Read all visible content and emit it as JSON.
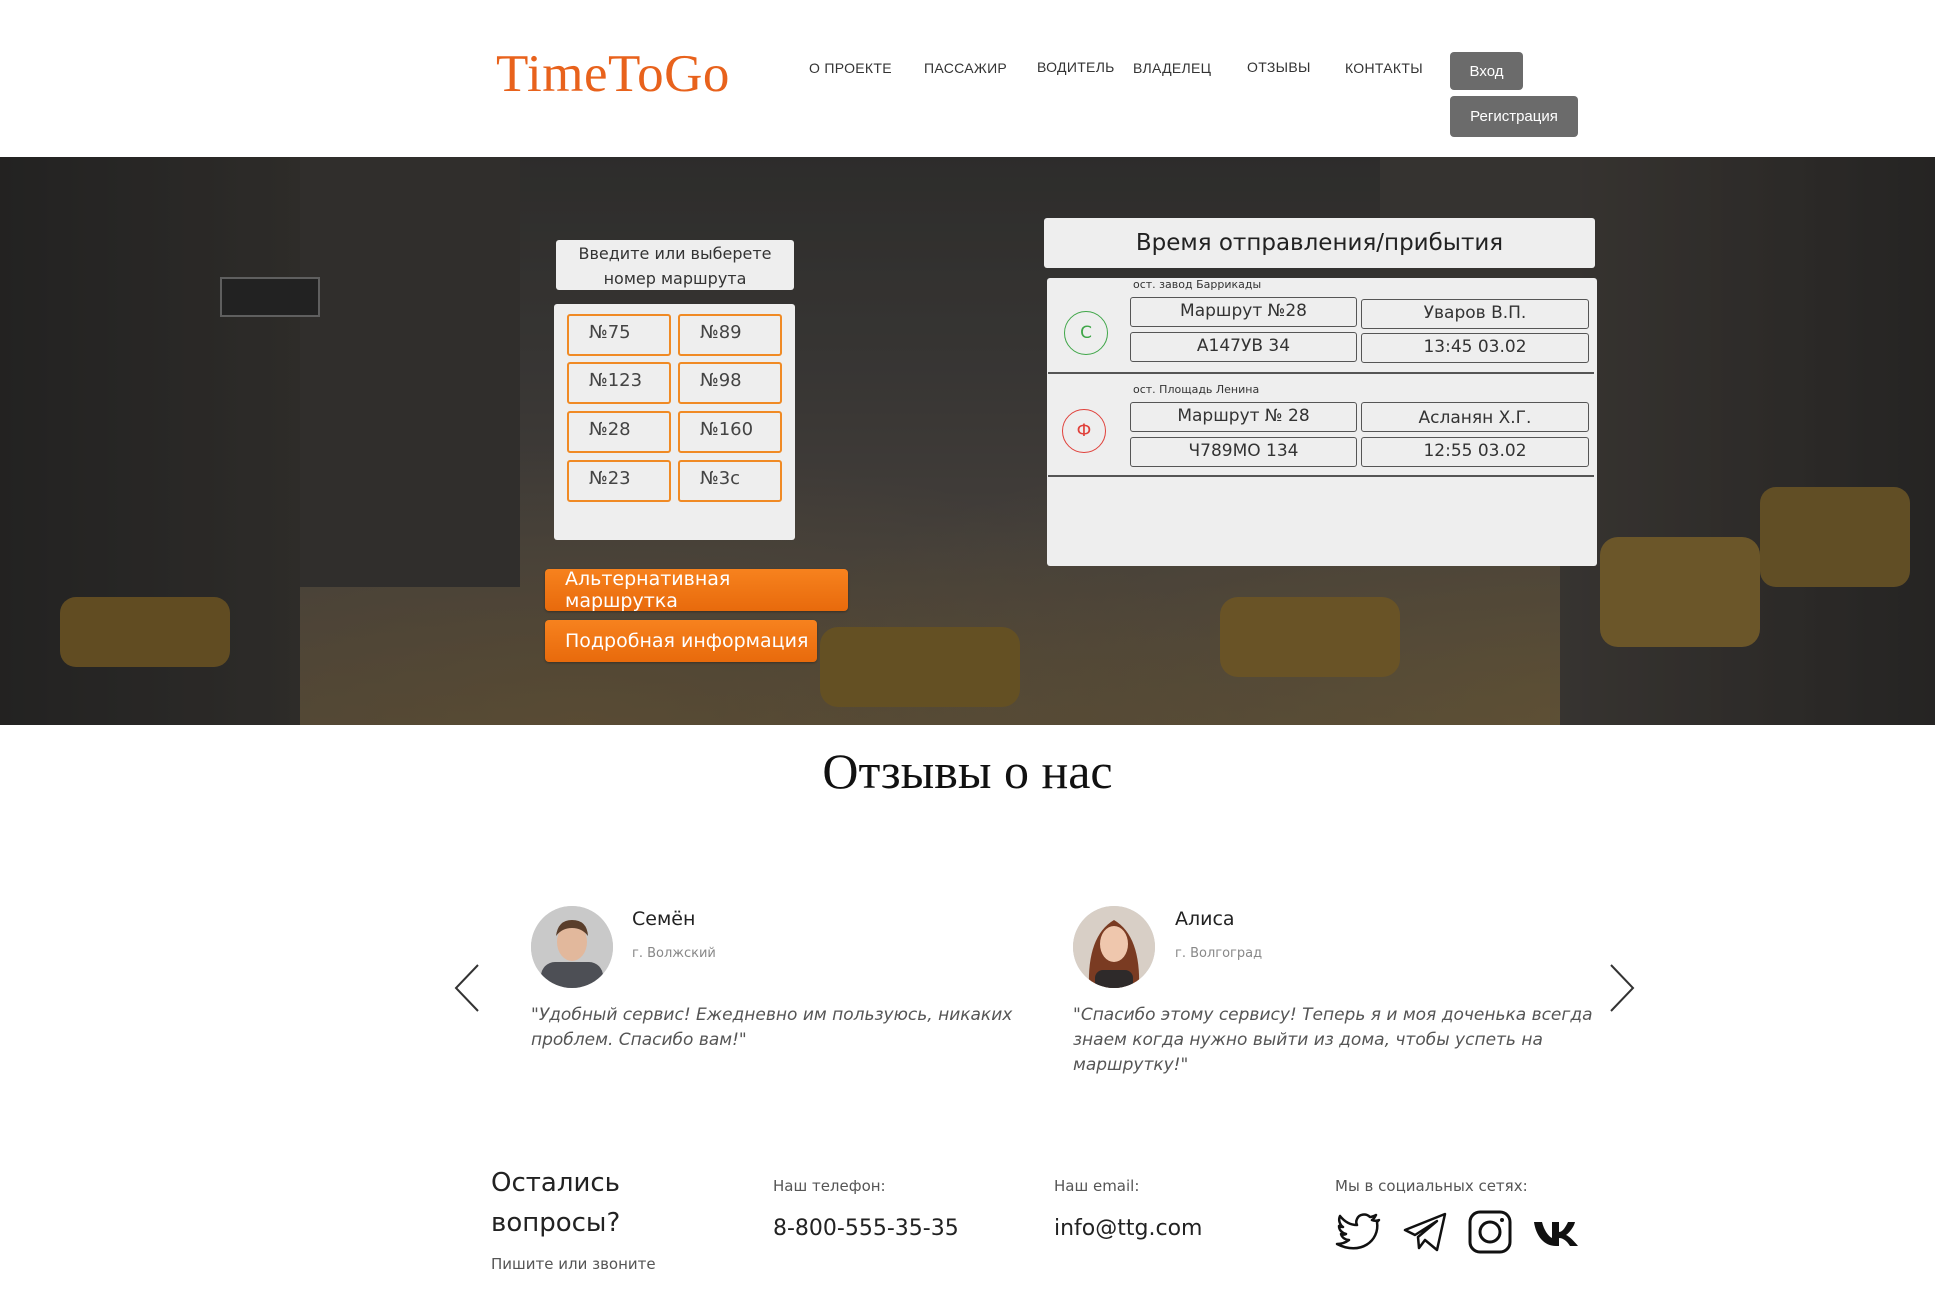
{
  "header": {
    "logo": "TimeToGo",
    "nav": [
      "О ПРОЕКТЕ",
      "ПАССАЖИР",
      "ВОДИТЕЛЬ",
      "ВЛАДЕЛЕЦ",
      "ОТЗЫВЫ",
      "КОНТАКТЫ"
    ],
    "login_label": "Вход",
    "register_label": "Регистрация"
  },
  "hero": {
    "route_prompt_line1": "Введите или выберете",
    "route_prompt_line2": "номер маршрута",
    "routes": [
      "№75",
      "№89",
      "№123",
      "№98",
      "№28",
      "№160",
      "№23",
      "№3с"
    ],
    "alt_button": "Альтернативная маршрутка",
    "info_button": "Подробная информация",
    "schedule": {
      "title": "Время отправления/прибытия",
      "entries": [
        {
          "stop": "ост. завод Баррикады",
          "marker": "С",
          "marker_color": "#3fa648",
          "route": "Маршрут №28",
          "driver": "Уваров В.П.",
          "plate": "А147УВ 34",
          "time": "13:45 03.02"
        },
        {
          "stop": "ост. Площадь Ленина",
          "marker": "Ф",
          "marker_color": "#e0403a",
          "route": "Маршрут № 28",
          "driver": "Асланян Х.Г.",
          "plate": "Ч789МО 134",
          "time": "12:55 03.02"
        }
      ]
    }
  },
  "reviews": {
    "title": "Отзывы о нас",
    "items": [
      {
        "name": "Семён",
        "city": "г. Волжский",
        "text_line1": "\"Удобный сервис! Ежедневно им пользуюсь, никаких",
        "text_line2": "проблем. Спасибо вам!\"",
        "text_line3": ""
      },
      {
        "name": "Алиса",
        "city": "г. Волгоград",
        "text_line1": "\"Спасибо этому сервису! Теперь я и моя доченька всегда",
        "text_line2": "знаем когда нужно выйти из дома, чтобы успеть на",
        "text_line3": "маршрутку!\""
      }
    ]
  },
  "footer": {
    "heading_line1": "Остались",
    "heading_line2": "вопросы?",
    "subheading": "Пишите или звоните",
    "phone_label": "Наш телефон:",
    "phone": "8-800-555-35-35",
    "email_label": "Наш email:",
    "email": "info@ttg.com",
    "social_label": "Мы в социальных сетях:",
    "social_icons": [
      "twitter-icon",
      "telegram-icon",
      "instagram-icon",
      "vk-icon"
    ]
  },
  "colors": {
    "brand_orange": "#e8621c",
    "button_gray": "#6b6b6b"
  }
}
